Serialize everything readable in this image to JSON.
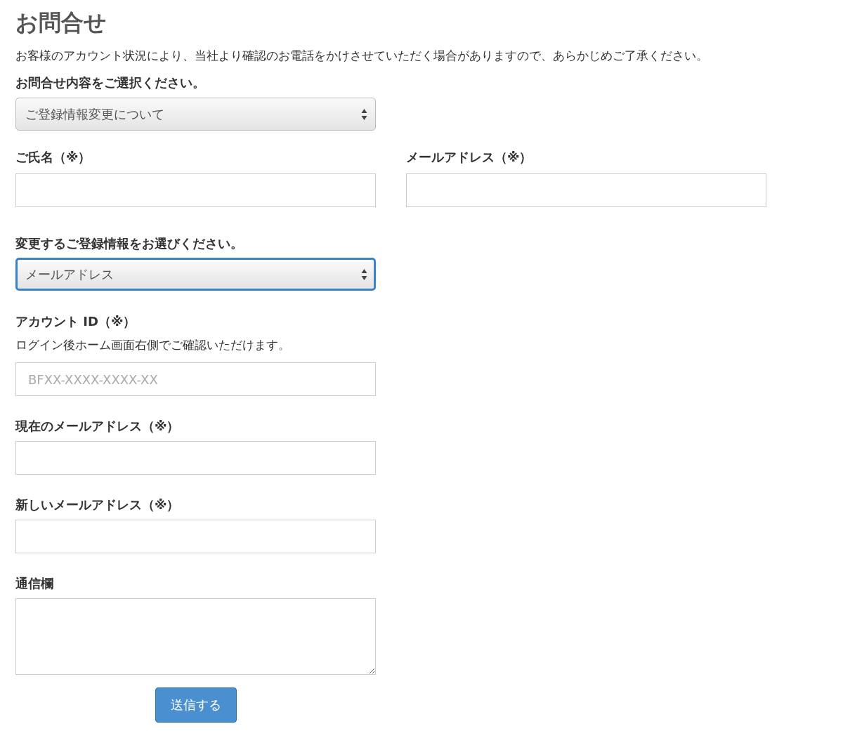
{
  "title": "お問合せ",
  "description": "お客様のアカウント状況により、当社より確認のお電話をかけさせていただく場合がありますので、あらかじめご了承ください。",
  "inquiry_type": {
    "label": "お問合せ内容をご選択ください。",
    "value": "ご登録情報変更について",
    "focused": false
  },
  "name_field": {
    "label": "ご氏名（※）"
  },
  "email_field": {
    "label": "メールアドレス（※）"
  },
  "change_item": {
    "label": "変更するご登録情報をお選びください。",
    "value": "メールアドレス",
    "focused": true
  },
  "account_id": {
    "label": "アカウント ID（※）",
    "hint": "ログイン後ホーム画面右側でご確認いただけます。",
    "placeholder": "BFXX-XXXX-XXXX-XX"
  },
  "current_email": {
    "label": "現在のメールアドレス（※）"
  },
  "new_email": {
    "label": "新しいメールアドレス（※）"
  },
  "message": {
    "label": "通信欄"
  },
  "submit": "送信する"
}
